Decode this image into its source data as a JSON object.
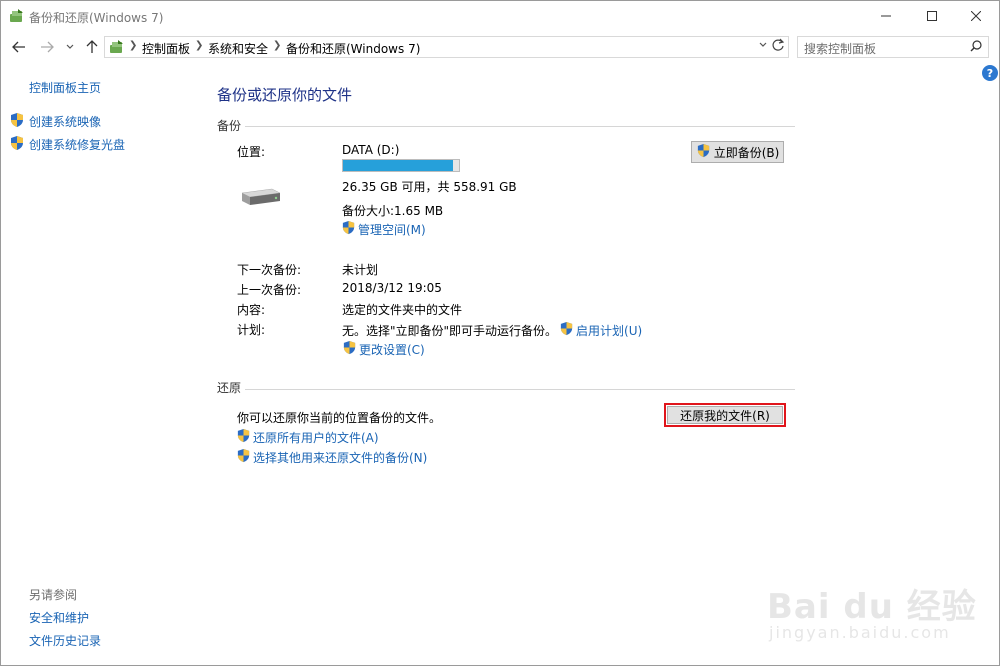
{
  "window": {
    "title": "备份和还原(Windows 7)"
  },
  "nav": {
    "breadcrumbs": [
      "控制面板",
      "系统和安全",
      "备份和还原(Windows 7)"
    ],
    "search_placeholder": "搜索控制面板"
  },
  "left_pane": {
    "home": "控制面板主页",
    "tasks": [
      "创建系统映像",
      "创建系统修复光盘"
    ],
    "see_also_title": "另请参阅",
    "see_also": [
      "安全和维护",
      "文件历史记录"
    ]
  },
  "main": {
    "title": "备份或还原你的文件",
    "backup": {
      "section_label": "备份",
      "location_label": "位置:",
      "drive_name": "DATA (D:)",
      "drive_used_fraction": 0.95,
      "space_text": "26.35 GB 可用，共 558.91 GB",
      "backup_size": "备份大小:1.65 MB",
      "manage_space": "管理空间(M)",
      "backup_now_button": "立即备份(B)",
      "next_backup_label": "下一次备份:",
      "next_backup_value": "未计划",
      "last_backup_label": "上一次备份:",
      "last_backup_value": "2018/3/12 19:05",
      "contents_label": "内容:",
      "contents_value": "选定的文件夹中的文件",
      "schedule_label": "计划:",
      "schedule_value": "无。选择\"立即备份\"即可手动运行备份。",
      "enable_schedule": "启用计划(U)",
      "change_settings": "更改设置(C)"
    },
    "restore": {
      "section_label": "还原",
      "description": "你可以还原你当前的位置备份的文件。",
      "restore_my_files_button": "还原我的文件(R)",
      "restore_all_users": "还原所有用户的文件(A)",
      "select_other_backup": "选择其他用来还原文件的备份(N)"
    }
  },
  "watermark": {
    "text": "Bai du 经验",
    "url": "jingyan.baidu.com"
  },
  "colors": {
    "link": "#1a64b4",
    "title": "#1e3287",
    "progress": "#26a0da",
    "highlight": "#e0151b"
  }
}
